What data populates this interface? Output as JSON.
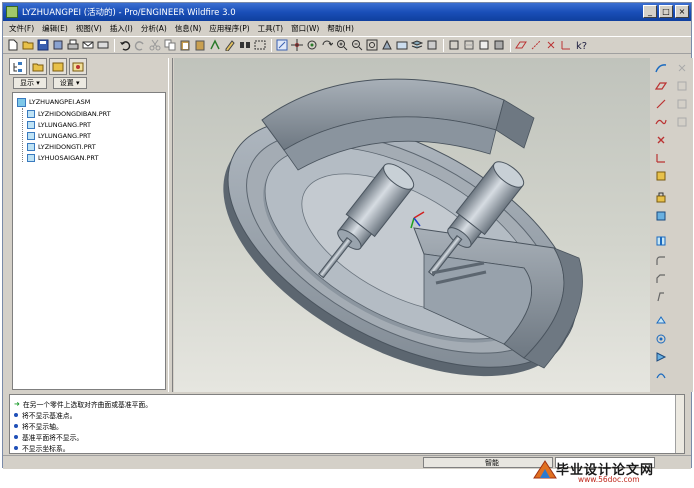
{
  "window": {
    "title": "LYZHUANGPEI (活动的) - Pro/ENGINEER Wildfire 3.0",
    "controls": [
      "_",
      "□",
      "×"
    ]
  },
  "menu": [
    "文件(F)",
    "编辑(E)",
    "视图(V)",
    "插入(I)",
    "分析(A)",
    "信息(N)",
    "应用程序(P)",
    "工具(T)",
    "窗口(W)",
    "帮助(H)"
  ],
  "navigator": {
    "show_button": "显示 ▾",
    "settings_button": "设置 ▾",
    "tree": {
      "root": "LYZHUANGPEI.ASM",
      "children": [
        "LYZHIDONGDIBAN.PRT",
        "LYLUNGANG.PRT",
        "LYLUNGANG.PRT",
        "LYZHIDONGTI.PRT",
        "LYHUOSAIGAN.PRT"
      ]
    }
  },
  "messages": [
    {
      "type": "prompt",
      "text": "在另一个零件上选取对齐曲面或基准平面。"
    },
    {
      "type": "info",
      "text": "将不显示基准点。"
    },
    {
      "type": "info",
      "text": "将不显示轴。"
    },
    {
      "type": "info",
      "text": "基准平面将不显示。"
    },
    {
      "type": "info",
      "text": "不显示坐标系。"
    }
  ],
  "status": {
    "filter_label": "智能"
  },
  "watermark": {
    "title": "毕业设计论文网",
    "url": "www.56doc.com"
  },
  "colors": {
    "title_bar": "#1a4fb8",
    "graphics_bg": "#d2d4cc",
    "model": "#9aa4ae",
    "model_shadow": "#5c6670"
  }
}
